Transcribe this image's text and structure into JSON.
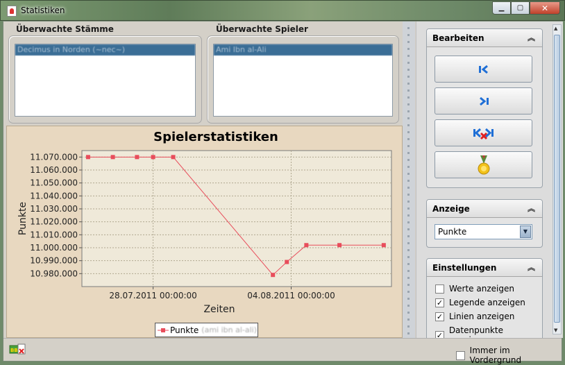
{
  "window": {
    "title": "Statistiken"
  },
  "tribes": {
    "title": "Überwachte Stämme",
    "selected": "Decimus in Norden (~nec~)"
  },
  "players": {
    "title": "Überwachte Spieler",
    "selected": "Ami Ibn al-Ali"
  },
  "chart_data": {
    "type": "line",
    "title": "Spielerstatistiken",
    "xlabel": "Zeiten",
    "ylabel": "Punkte",
    "ylim": [
      10970000,
      11075000
    ],
    "yticks": [
      "11.070.000",
      "11.060.000",
      "11.050.000",
      "11.040.000",
      "11.030.000",
      "11.020.000",
      "11.010.000",
      "11.000.000",
      "10.990.000",
      "10.980.000"
    ],
    "ytick_values": [
      11070000,
      11060000,
      11050000,
      11040000,
      11030000,
      11020000,
      11010000,
      11000000,
      10990000,
      10980000
    ],
    "xticks": [
      "28.07.2011 00:00:00",
      "04.08.2011 00:00:00"
    ],
    "xtick_positions": [
      0.23,
      0.676
    ],
    "series": [
      {
        "name": "Punkte",
        "color": "#e84d5b",
        "x": [
          0.02,
          0.1,
          0.178,
          0.23,
          0.295,
          0.617,
          0.662,
          0.725,
          0.832,
          0.975
        ],
        "values": [
          11070000,
          11070000,
          11070000,
          11070000,
          11070000,
          10979000,
          10989000,
          11002000,
          11002000,
          11002000
        ]
      }
    ],
    "legend": {
      "label": "Punkte",
      "extra": "(ami ibn al-ali)",
      "position": "bottom"
    },
    "grid": true
  },
  "sidebar": {
    "edit": {
      "title": "Bearbeiten"
    },
    "display": {
      "title": "Anzeige",
      "selected": "Punkte"
    },
    "settings": {
      "title": "Einstellungen",
      "options": [
        {
          "label": "Werte anzeigen",
          "checked": false
        },
        {
          "label": "Legende anzeigen",
          "checked": true
        },
        {
          "label": "Linien anzeigen",
          "checked": true
        },
        {
          "label": "Datenpunkte anzeigen",
          "checked": true
        }
      ]
    }
  },
  "footer": {
    "always_on_top": "Immer im Vordergrund",
    "always_on_top_checked": false
  }
}
